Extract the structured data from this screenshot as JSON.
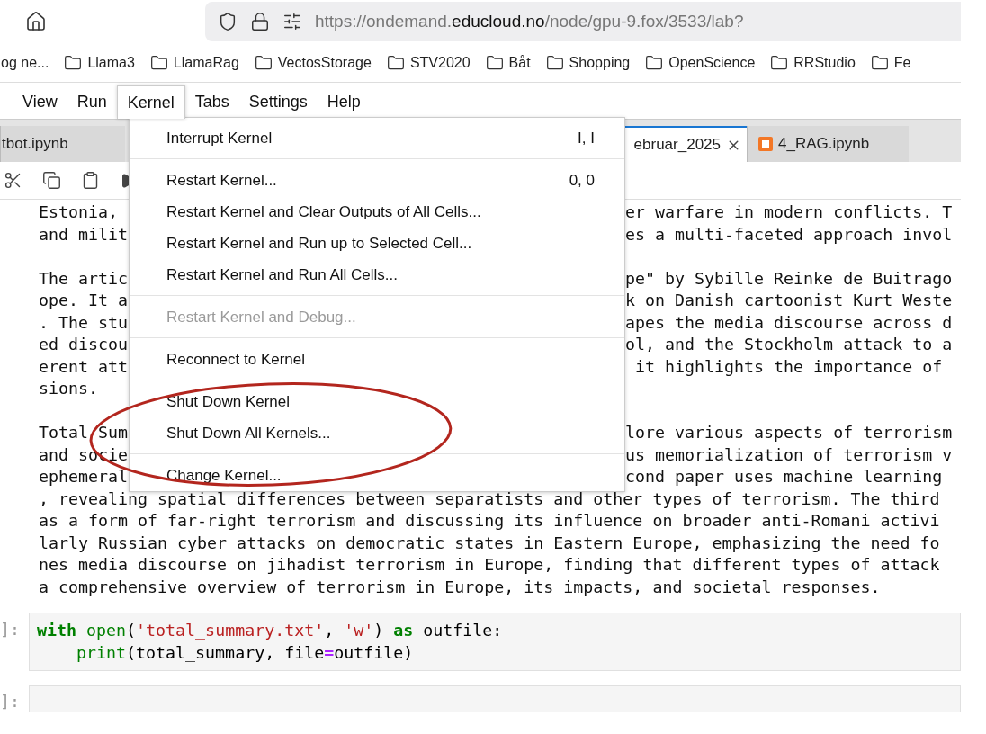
{
  "browser": {
    "url_scheme_host": "https://ondemand.",
    "url_domain": "educloud.no",
    "url_path": "/node/gpu-9.fox/3533/lab?"
  },
  "bookmarks": [
    {
      "kind": "plain",
      "label": "og ne..."
    },
    {
      "kind": "folder",
      "label": "Llama3"
    },
    {
      "kind": "folder",
      "label": "LlamaRag"
    },
    {
      "kind": "folder",
      "label": "VectosStorage"
    },
    {
      "kind": "folder",
      "label": "STV2020"
    },
    {
      "kind": "folder",
      "label": "Båt"
    },
    {
      "kind": "folder",
      "label": "Shopping"
    },
    {
      "kind": "folder",
      "label": "OpenScience"
    },
    {
      "kind": "folder",
      "label": "RRStudio"
    },
    {
      "kind": "folder",
      "label": "Fe"
    }
  ],
  "menubar": [
    {
      "label": "View",
      "selected": false
    },
    {
      "label": "Run",
      "selected": false
    },
    {
      "label": "Kernel",
      "selected": true
    },
    {
      "label": "Tabs",
      "selected": false
    },
    {
      "label": "Settings",
      "selected": false
    },
    {
      "label": "Help",
      "selected": false
    }
  ],
  "tabs": [
    {
      "label": "tbot.ipynb",
      "kind": "plain",
      "selected": false
    },
    {
      "label": "ebruar_2025",
      "kind": "closable",
      "selected": true
    },
    {
      "label": "4_RAG.ipynb",
      "kind": "notebook",
      "selected": false
    }
  ],
  "kernel_menu": [
    [
      {
        "label": "Interrupt Kernel",
        "shortcut": "I, I",
        "disabled": false
      }
    ],
    [
      {
        "label": "Restart Kernel...",
        "shortcut": "0, 0",
        "disabled": false
      },
      {
        "label": "Restart Kernel and Clear Outputs of All Cells...",
        "disabled": false
      },
      {
        "label": "Restart Kernel and Run up to Selected Cell...",
        "disabled": false
      },
      {
        "label": "Restart Kernel and Run All Cells...",
        "disabled": false
      }
    ],
    [
      {
        "label": "Restart Kernel and Debug...",
        "disabled": true
      }
    ],
    [
      {
        "label": "Reconnect to Kernel",
        "disabled": false
      }
    ],
    [
      {
        "label": "Shut Down Kernel",
        "disabled": false
      },
      {
        "label": "Shut Down All Kernels...",
        "disabled": false
      }
    ],
    [
      {
        "label": "Change Kernel...",
        "disabled": false
      }
    ]
  ],
  "output_lines": [
    {
      "kind": "split",
      "left": "Estonia,",
      "right": "er warfare in modern conflicts. T"
    },
    {
      "kind": "split",
      "left": "and milit",
      "right": "es a multi-faceted approach invol"
    },
    {
      "kind": "blank"
    },
    {
      "kind": "split",
      "left": "The artic",
      "right": "pe\" by Sybille Reinke de Buitrago"
    },
    {
      "kind": "split",
      "left": "ope. It a",
      "right": "k on Danish cartoonist Kurt Weste"
    },
    {
      "kind": "split",
      "left": ". The stu",
      "right": "apes the media discourse across d"
    },
    {
      "kind": "split",
      "left": "ed discou",
      "right": "ol, and the Stockholm attack to a"
    },
    {
      "kind": "split",
      "left": "erent att",
      "right": " it highlights the importance of"
    },
    {
      "kind": "full",
      "text": "sions."
    },
    {
      "kind": "blank"
    },
    {
      "kind": "split",
      "left": "Total Sum",
      "right": "lore various aspects of terrorism"
    },
    {
      "kind": "split",
      "left": "and socie",
      "right": "us memorialization of terrorism v"
    },
    {
      "kind": "split",
      "left": "ephemeral",
      "right": "cond paper uses machine learning"
    },
    {
      "kind": "full",
      "text": ", revealing spatial differences between separatists and other types of terrorism. The third"
    },
    {
      "kind": "full",
      "text": "as a form of far-right terrorism and discussing its influence on broader anti-Romani activi"
    },
    {
      "kind": "full",
      "text": "larly Russian cyber attacks on democratic states in Eastern Europe, emphasizing the need fo"
    },
    {
      "kind": "full",
      "text": "nes media discourse on jihadist terrorism in Europe, finding that different types of attack"
    },
    {
      "kind": "full",
      "text": "a comprehensive overview of terrorism in Europe, its impacts, and societal responses."
    }
  ],
  "code_cell": {
    "prompt": "]:",
    "lines": [
      [
        {
          "t": "with",
          "kind": "keyword"
        },
        {
          "t": " open",
          "kind": "builtin"
        },
        {
          "t": "(",
          "kind": "plain"
        },
        {
          "t": "'total_summary.txt'",
          "kind": "string"
        },
        {
          "t": ", ",
          "kind": "plain"
        },
        {
          "t": "'w'",
          "kind": "string"
        },
        {
          "t": ") ",
          "kind": "plain"
        },
        {
          "t": "as",
          "kind": "keyword"
        },
        {
          "t": " outfile:",
          "kind": "plain"
        }
      ],
      [
        {
          "t": "    print",
          "kind": "builtin"
        },
        {
          "t": "(total_summary, file",
          "kind": "plain"
        },
        {
          "t": "=",
          "kind": "operator"
        },
        {
          "t": "outfile)",
          "kind": "plain"
        }
      ]
    ]
  },
  "empty_cell": {
    "prompt": "]:"
  }
}
